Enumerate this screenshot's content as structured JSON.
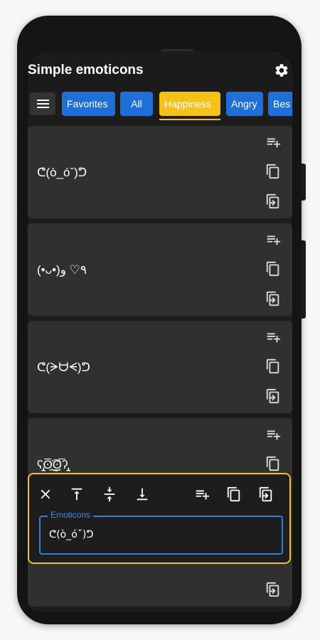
{
  "app": {
    "title": "Simple emoticons"
  },
  "tabs": [
    {
      "label": "Favorites",
      "selected": false
    },
    {
      "label": "All",
      "selected": false
    },
    {
      "label": "Happiness",
      "selected": true
    },
    {
      "label": "Angry",
      "selected": false
    },
    {
      "label": "Bes",
      "selected": false
    }
  ],
  "emoticons": [
    "ᕦ(ò_óˇ)ᕤ",
    "(•ᴗ•)٩♡ ﻭ",
    "ᕦ(ᗒᗨᗕ)ᕤ",
    "ʕ̡̢̡ʘ̅͟͜͡ʘ̲̅ʔ̢̡̢"
  ],
  "card_actions": [
    "add-to-list-icon",
    "copy-icon",
    "open-in-icon"
  ],
  "editor": {
    "tools": [
      "close-icon",
      "align-top-icon",
      "align-center-icon",
      "align-bottom-icon",
      "add-to-list-icon",
      "copy-icon",
      "open-in-icon"
    ],
    "field_label": "Emoticons",
    "field_value": "ᕦ(ò_óˇ)ᕤ"
  },
  "colors": {
    "accent_selected": "#f5c018",
    "tab_blue": "#1f6fd9",
    "field_border": "#2f7fd4",
    "card_bg": "#303030",
    "screen_bg": "#1c1c1c"
  }
}
